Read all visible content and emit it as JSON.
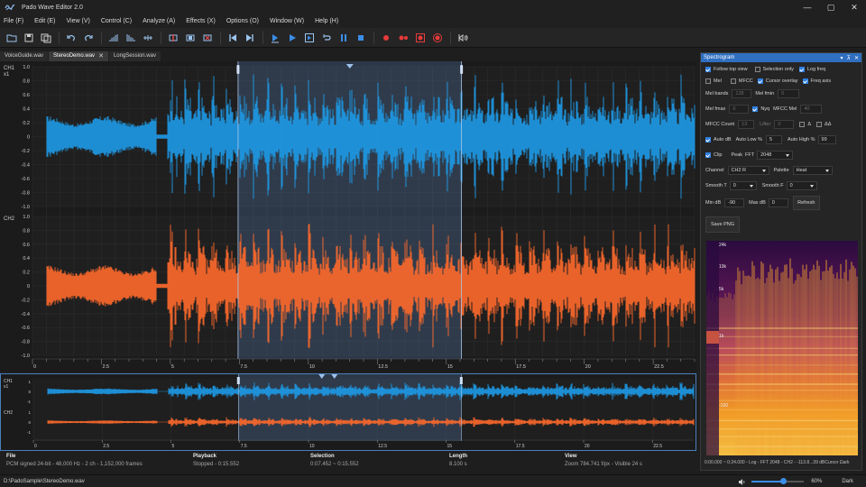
{
  "window": {
    "title": "Pado Wave Editor 2.0",
    "controls": [
      "—",
      "▢",
      "✕"
    ]
  },
  "menu": [
    "File (F)",
    "Edit (E)",
    "View (V)",
    "Control (C)",
    "Analyze (A)",
    "Effects (X)",
    "Options (O)",
    "Window (W)",
    "Help (H)"
  ],
  "tabs": [
    {
      "label": "VoiceGuide.wav",
      "active": false
    },
    {
      "label": "StereoDemo.wav",
      "active": true
    },
    {
      "label": "LongSession.wav",
      "active": false
    }
  ],
  "channels": {
    "ch1_label": "CH1",
    "ch1_sub": "x1",
    "ch2_label": "CH2",
    "ch1_color": "#1e9be8",
    "ch2_color": "#ff6a2c"
  },
  "amplitude_ticks_ch1": [
    "1.0",
    "0.8",
    "0.6",
    "0.4",
    "0.2",
    "0",
    "-0.2",
    "-0.4",
    "-0.6",
    "-0.8",
    "-1.0"
  ],
  "amplitude_ticks_ch2": [
    "1.0",
    "0.8",
    "0.6",
    "0.4",
    "0.2",
    "0",
    "-0.2",
    "-0.4",
    "-0.6",
    "-0.8",
    "-1.0"
  ],
  "time_ticks": [
    "0",
    "2.5",
    "5",
    "7.5",
    "10",
    "12.5",
    "15",
    "17.5",
    "20",
    "22.5"
  ],
  "overview_ticks": [
    "0",
    "2.5",
    "5",
    "7.5",
    "10",
    "12.5",
    "15",
    "17.5",
    "20",
    "22.5"
  ],
  "overview": {
    "ch1_label": "CH1",
    "ch1_sub": "x1",
    "ch2_label": "CH2",
    "ch1_ticks": [
      "1",
      "0",
      "-1"
    ],
    "ch2_ticks": [
      "1",
      "0",
      "-1"
    ]
  },
  "waveform": {
    "duration_s": 24,
    "selection_start_s": 7.452,
    "selection_end_s": 15.552,
    "view_visible_s": 24
  },
  "info": [
    {
      "label": "File",
      "value": "PCM signed 24-bit - 48,000 Hz - 2 ch - 1,152,000 frames"
    },
    {
      "label": "Playback",
      "value": "Stopped - 0:15.552"
    },
    {
      "label": "Selection",
      "value": "0:07.452 ~ 0:15.552"
    },
    {
      "label": "Length",
      "value": "8.100 s"
    },
    {
      "label": "View",
      "value": "Zoom 784.741 f/px - Visible 24 s"
    }
  ],
  "status": {
    "path": "D:\\PadoSample\\StereoDemo.wav",
    "volume_pct": 60,
    "volume_label": "60%",
    "theme": "Dark"
  },
  "spectrogram": {
    "title": "Spectrogram",
    "header_icons": [
      "▾",
      "⊼",
      "✕"
    ],
    "follow_top_view": {
      "label": "Follow top view",
      "checked": true
    },
    "selection_only": {
      "label": "Selection only",
      "checked": false
    },
    "log_freq": {
      "label": "Log freq",
      "checked": true
    },
    "mel": {
      "label": "Mel",
      "checked": false
    },
    "mfcc": {
      "label": "MFCC",
      "checked": false
    },
    "cursor_overlay": {
      "label": "Cursor overlay",
      "checked": true
    },
    "freq_axis": {
      "label": "Freq axis",
      "checked": true
    },
    "mel_bands_label": "Mel bands",
    "mel_bands_value": "128",
    "mel_fmin_label": "Mel fmin",
    "mel_fmin_value": "0",
    "mel_fmax_label": "Mel fmax",
    "mel_fmax_value": "0",
    "nyq": {
      "label": "Nyq",
      "checked": true
    },
    "mfcc_mel_label": "MFCC Mel",
    "mfcc_mel_value": "40",
    "mfcc_count_label": "MFCC Count",
    "mfcc_count_value": "13",
    "lifter_label": "Lifter",
    "lifter_value": "0",
    "delta": {
      "label": "Δ",
      "checked": false
    },
    "delta_delta": {
      "label": "ΔΔ",
      "checked": false
    },
    "auto_db": {
      "label": "Auto dB",
      "checked": true
    },
    "auto_low_label": "Auto Low %",
    "auto_low_value": "5",
    "auto_high_label": "Auto High %",
    "auto_high_value": "99",
    "clip": {
      "label": "Clip",
      "checked": true
    },
    "peak_label": "Peak",
    "fft_label": "FFT",
    "fft_value": "2048",
    "channel_label": "Channel",
    "channel_value": "CH2 R",
    "palette_label": "Palette",
    "palette_value": "Heat",
    "smooth_t_label": "Smooth T",
    "smooth_t_value": "0",
    "smooth_f_label": "Smooth F",
    "smooth_f_value": "0",
    "min_db_label": "Min dB",
    "min_db_value": "-90",
    "max_db_label": "Max dB",
    "max_db_value": "0",
    "refresh_label": "Refresh",
    "save_png_label": "Save PNG",
    "freq_labels": [
      "24k",
      "10k",
      "5k",
      "1k",
      "-100"
    ],
    "status_text": "0:00.000 ~ 0:24.000 - Log - FFT 2048 - CH2 - -113.8...39 dBCursor ...",
    "status_theme": "Dark"
  }
}
